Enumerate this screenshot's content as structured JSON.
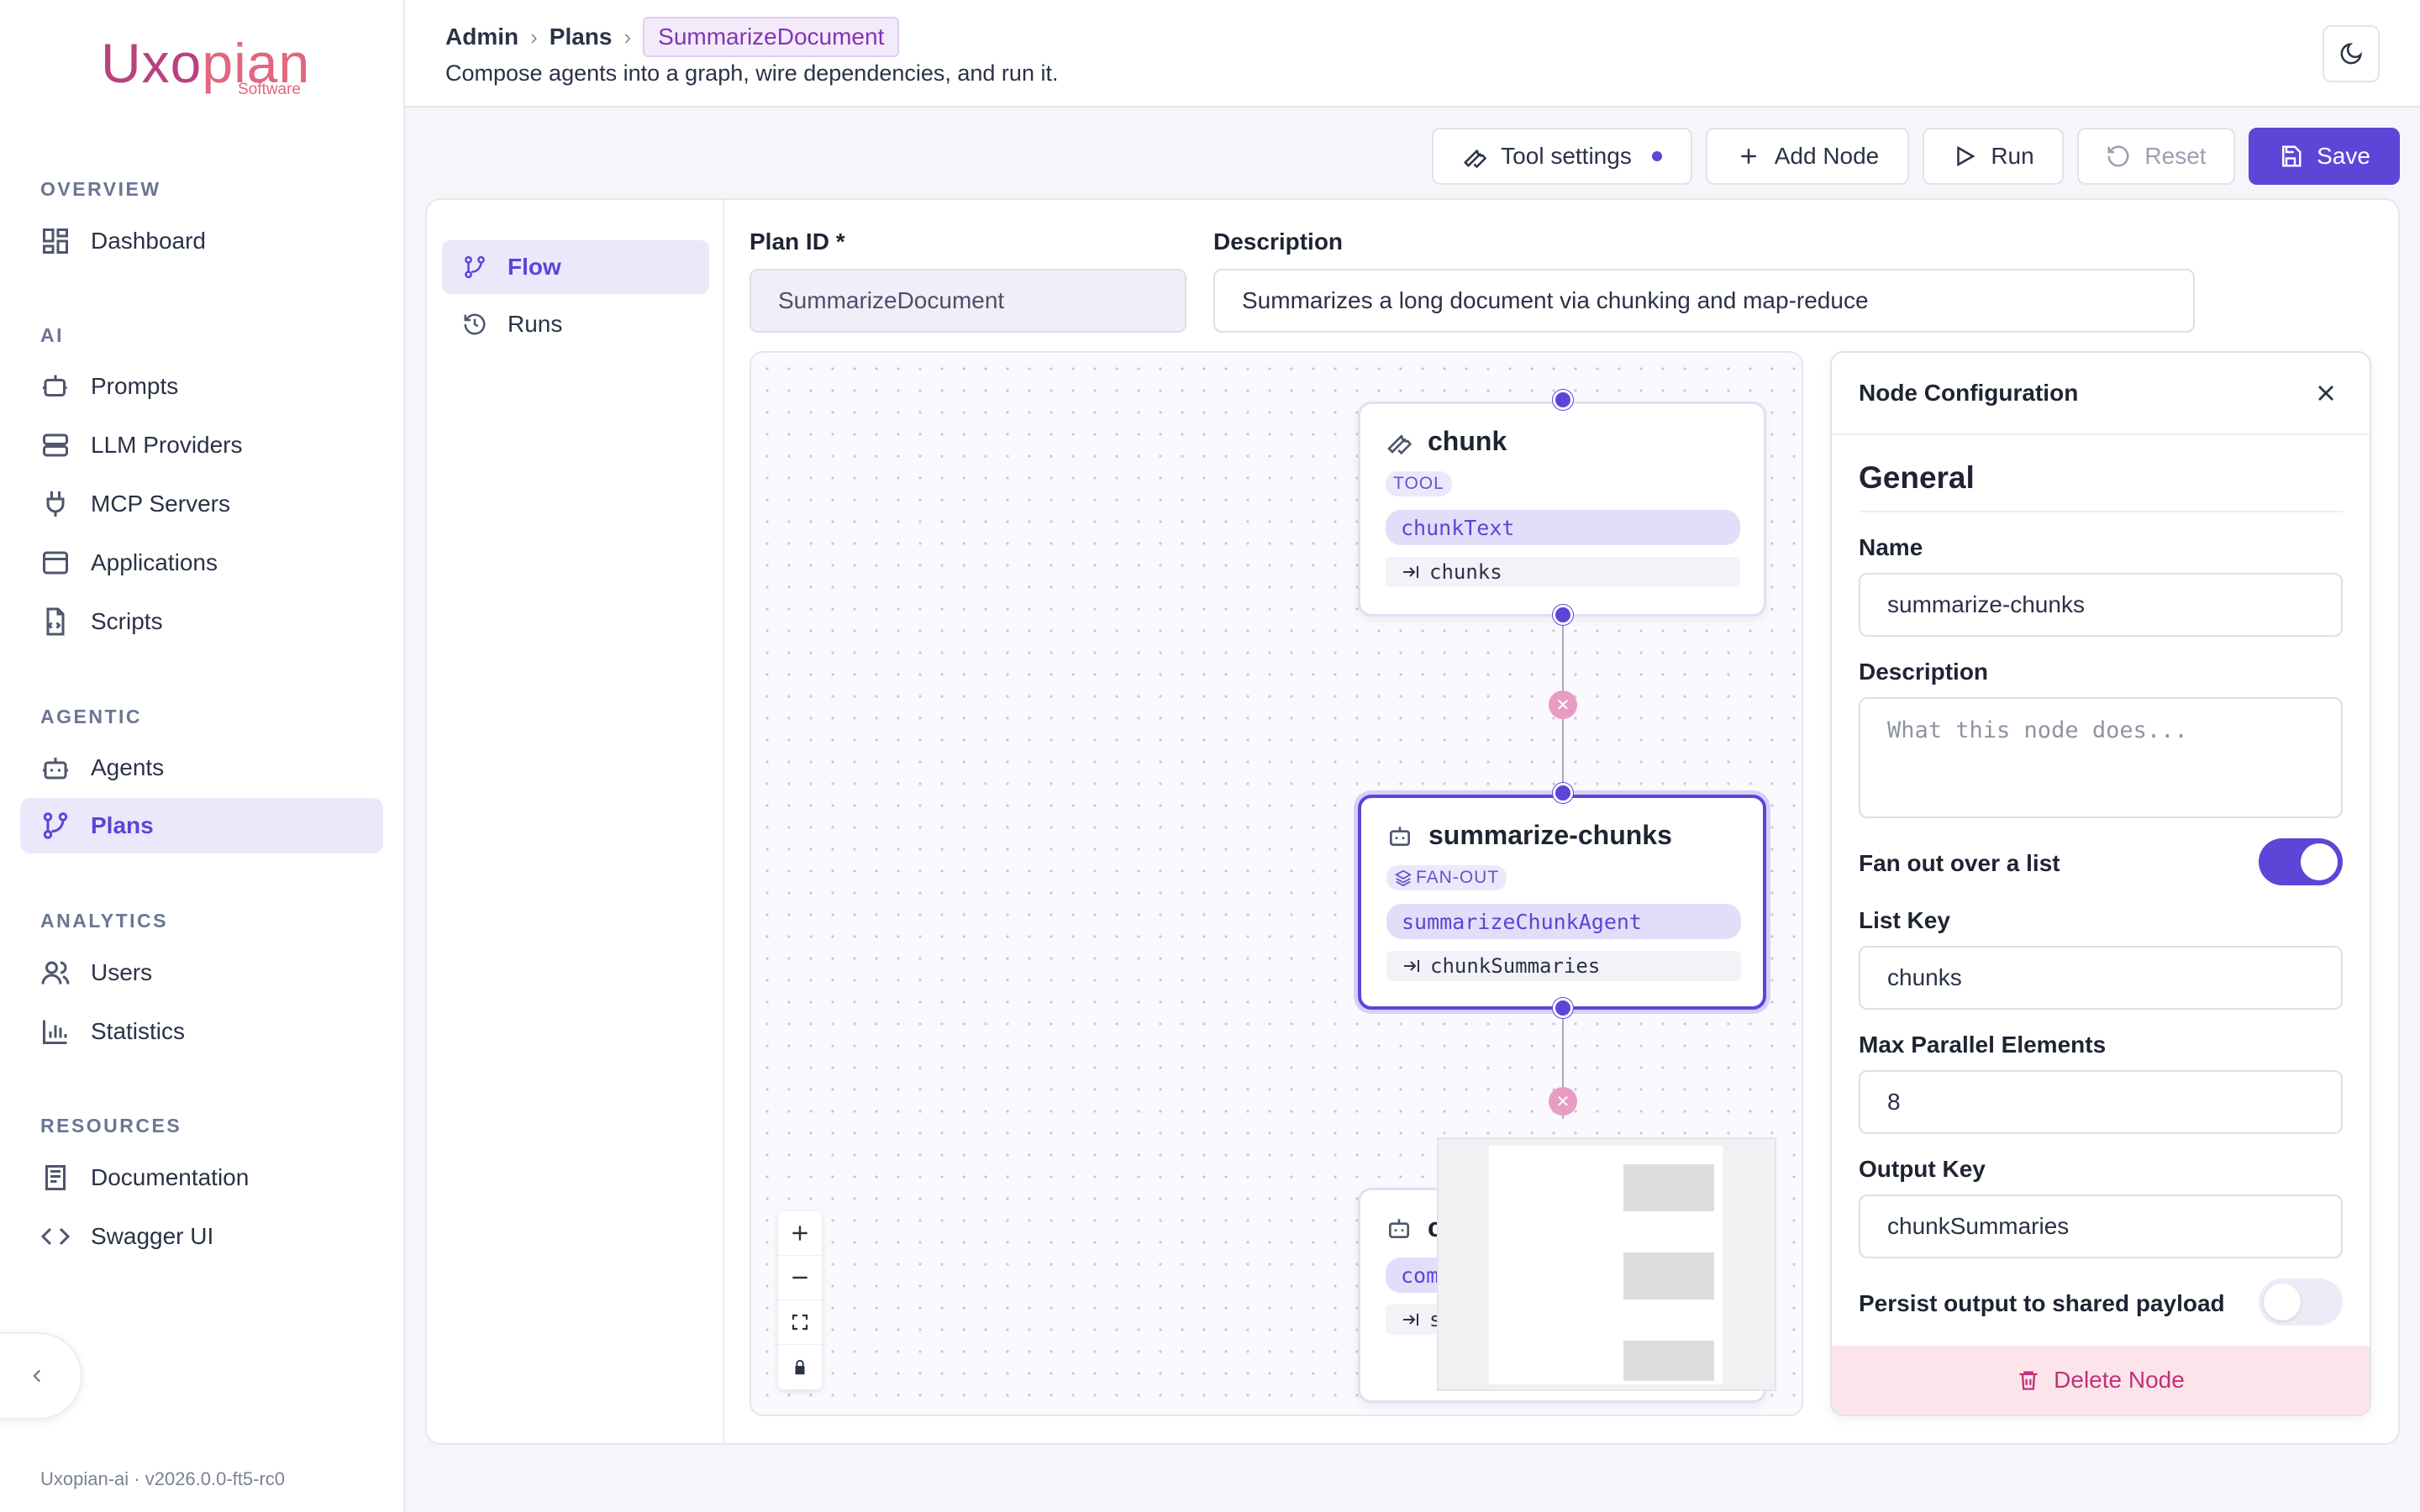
{
  "brand": {
    "name_left": "Uxo",
    "name_right": "pian",
    "tagline": "Software"
  },
  "sidebar": {
    "sections": [
      {
        "label": "OVERVIEW",
        "items": [
          {
            "label": "Dashboard",
            "icon": "dashboard-icon"
          }
        ]
      },
      {
        "label": "AI",
        "items": [
          {
            "label": "Prompts",
            "icon": "prompt-icon"
          },
          {
            "label": "LLM Providers",
            "icon": "server-icon"
          },
          {
            "label": "MCP Servers",
            "icon": "plug-icon"
          },
          {
            "label": "Applications",
            "icon": "window-icon"
          },
          {
            "label": "Scripts",
            "icon": "script-icon"
          }
        ]
      },
      {
        "label": "AGENTIC",
        "items": [
          {
            "label": "Agents",
            "icon": "bot-icon"
          },
          {
            "label": "Plans",
            "icon": "git-branch-icon",
            "active": true
          }
        ]
      },
      {
        "label": "ANALYTICS",
        "items": [
          {
            "label": "Users",
            "icon": "users-icon"
          },
          {
            "label": "Statistics",
            "icon": "bar-chart-icon"
          }
        ]
      },
      {
        "label": "RESOURCES",
        "items": [
          {
            "label": "Documentation",
            "icon": "book-icon"
          },
          {
            "label": "Swagger UI",
            "icon": "code-icon"
          }
        ]
      }
    ],
    "version": "Uxopian-ai · v2026.0.0-ft5-rc0"
  },
  "header": {
    "breadcrumb": [
      "Admin",
      "Plans",
      "SummarizeDocument"
    ],
    "subtitle": "Compose agents into a graph, wire dependencies, and run it."
  },
  "toolbar": {
    "tool_settings": "Tool settings",
    "add_node": "Add Node",
    "run": "Run",
    "reset": "Reset",
    "save": "Save"
  },
  "tabs": [
    {
      "label": "Flow",
      "active": true
    },
    {
      "label": "Runs"
    }
  ],
  "plan": {
    "id_label": "Plan ID *",
    "id_value": "SummarizeDocument",
    "description_label": "Description",
    "description_value": "Summarizes a long document via chunking and map-reduce"
  },
  "nodes": [
    {
      "name": "chunk",
      "badge": "TOOL",
      "ref": "chunkText",
      "output": "chunks"
    },
    {
      "name": "summarize-chunks",
      "badge": "FAN-OUT",
      "ref": "summarizeChunkAgent",
      "output": "chunkSummaries",
      "selected": true
    },
    {
      "name": "c",
      "ref": "com",
      "output": "s"
    }
  ],
  "config": {
    "title": "Node Configuration",
    "section": "General",
    "name_label": "Name",
    "name_value": "summarize-chunks",
    "description_label": "Description",
    "description_placeholder": "What this node does...",
    "fanout_label": "Fan out over a list",
    "fanout_on": true,
    "list_key_label": "List Key",
    "list_key_value": "chunks",
    "max_parallel_label": "Max Parallel Elements",
    "max_parallel_value": "8",
    "output_key_label": "Output Key",
    "output_key_value": "chunkSummaries",
    "persist_label": "Persist output to shared payload",
    "persist_on": false,
    "delete_label": "Delete Node"
  },
  "colors": {
    "accent": "#5b46d8",
    "brand": "#b9427d",
    "danger": "#c2307a"
  }
}
